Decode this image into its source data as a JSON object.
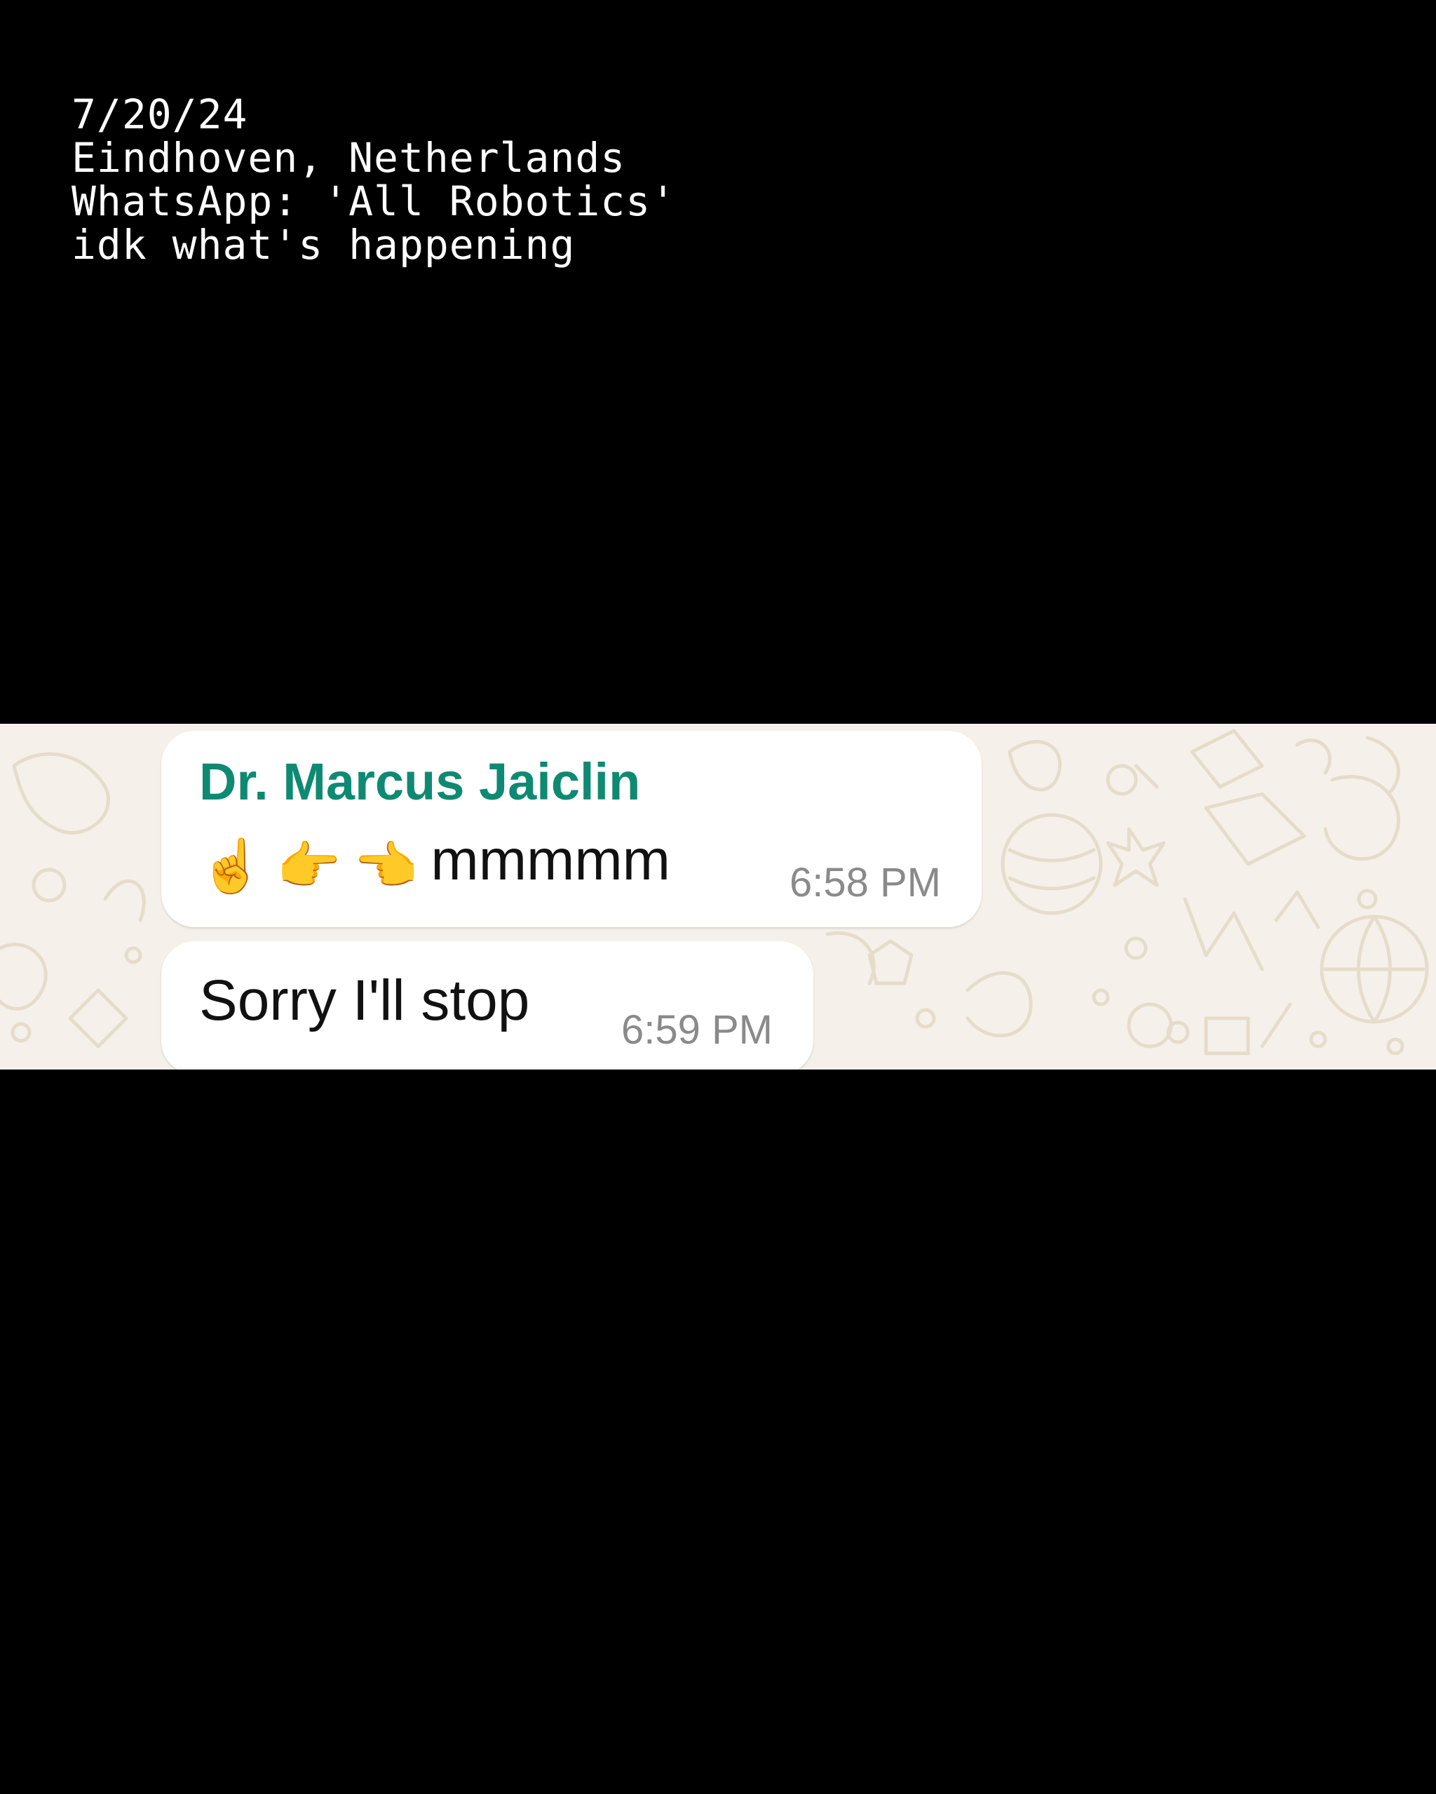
{
  "caption": {
    "lines": [
      "7/20/24",
      "Eindhoven, Netherlands",
      "WhatsApp: 'All Robotics'",
      "idk what's happening"
    ]
  },
  "chat": {
    "messages": [
      {
        "sender": "Dr. Marcus Jaiclin",
        "emojis": [
          "☝️",
          "👉",
          "👈"
        ],
        "text": "mmmmm",
        "time": "6:58 PM"
      },
      {
        "text": "Sorry I'll stop",
        "time": "6:59 PM"
      }
    ]
  },
  "colors": {
    "sender_name": "#0f8a72",
    "chat_background": "#f5f1ea",
    "bubble": "#ffffff",
    "timestamp": "#8a8a8a"
  }
}
